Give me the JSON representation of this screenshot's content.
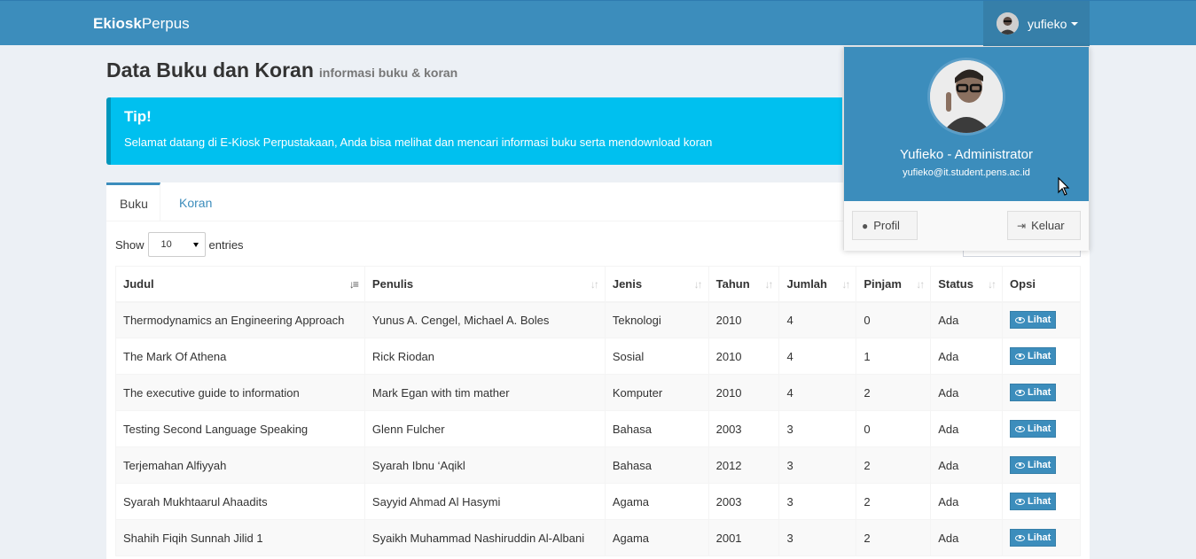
{
  "navbar": {
    "brand_bold": "Ekiosk",
    "brand_light": "Perpus",
    "username": "yufieko"
  },
  "page": {
    "title": "Data Buku dan Koran",
    "subtitle": "informasi buku & koran"
  },
  "callout": {
    "title": "Tip!",
    "text": "Selamat datang di E-Kiosk Perpustakaan, Anda bisa melihat dan mencari informasi buku serta mendownload koran"
  },
  "tabs": [
    {
      "label": "Buku"
    },
    {
      "label": "Koran"
    }
  ],
  "length": {
    "show": "Show",
    "value": "10",
    "entries": "entries"
  },
  "table": {
    "headers": [
      "Judul",
      "Penulis",
      "Jenis",
      "Tahun",
      "Jumlah",
      "Pinjam",
      "Status",
      "Opsi"
    ],
    "action_label": "Lihat",
    "rows": [
      [
        "Thermodynamics an Engineering Approach",
        "Yunus A. Cengel, Michael A. Boles",
        "Teknologi",
        "2010",
        "4",
        "0",
        "Ada"
      ],
      [
        "The Mark Of Athena",
        "Rick Riodan",
        "Sosial",
        "2010",
        "4",
        "1",
        "Ada"
      ],
      [
        "The executive guide to information",
        "Mark Egan with tim mather",
        "Komputer",
        "2010",
        "4",
        "2",
        "Ada"
      ],
      [
        "Testing Second Language Speaking",
        "Glenn Fulcher",
        "Bahasa",
        "2003",
        "3",
        "0",
        "Ada"
      ],
      [
        "Terjemahan Alfiyyah",
        "Syarah Ibnu ‘Aqikl",
        "Bahasa",
        "2012",
        "3",
        "2",
        "Ada"
      ],
      [
        "Syarah Mukhtaarul Ahaadits",
        "Sayyid Ahmad Al Hasymi",
        "Agama",
        "2003",
        "3",
        "2",
        "Ada"
      ],
      [
        "Shahih Fiqih Sunnah Jilid 1",
        "Syaikh Muhammad Nashiruddin Al-Albani",
        "Agama",
        "2001",
        "3",
        "2",
        "Ada"
      ]
    ]
  },
  "user_menu": {
    "name": "Yufieko - Administrator",
    "email": "yufieko@it.student.pens.ac.id",
    "profile_label": "Profil",
    "logout_label": "Keluar"
  },
  "colors": {
    "primary": "#3c8dbc",
    "callout": "#00c0ef",
    "background": "#ecf0f5"
  }
}
